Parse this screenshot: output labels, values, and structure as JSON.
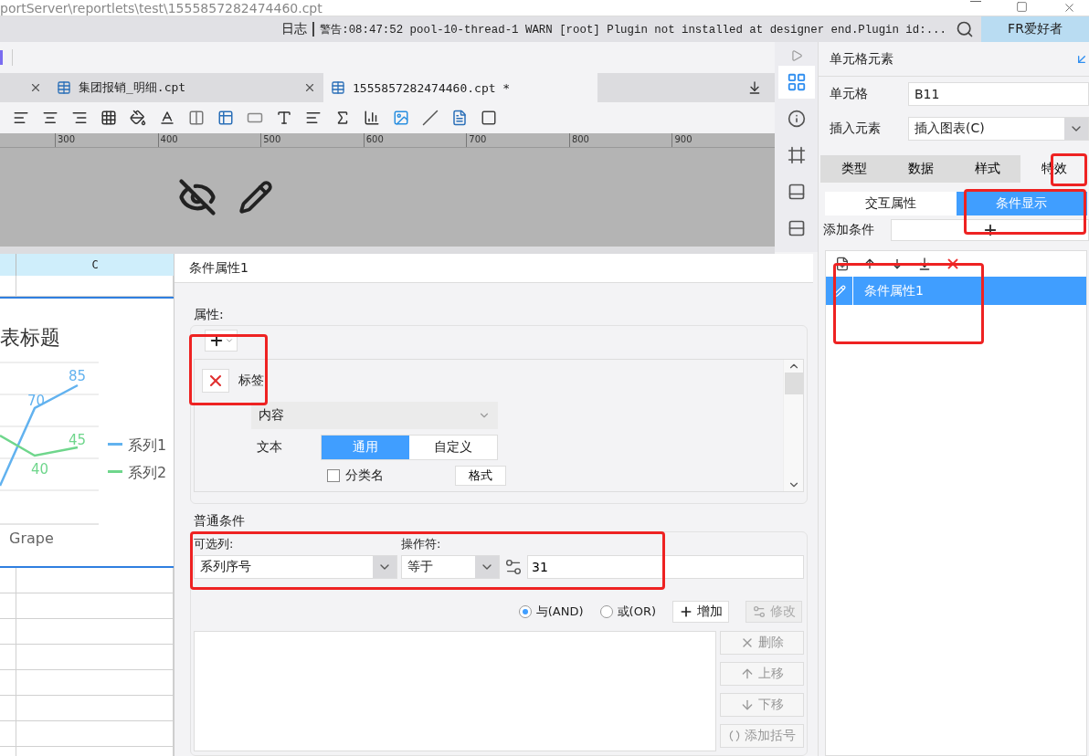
{
  "title_bar": {
    "path": "portServer\\reportlets\\test\\1555857282474460.cpt"
  },
  "log_bar": {
    "label": "日志",
    "message": "警告:08:47:52 pool-10-thread-1 WARN [root] Plugin not installed at designer end.Plugin id:...",
    "user": "FR爱好者"
  },
  "file_tabs": [
    {
      "selected": false
    },
    {
      "label": "集团报销_明细.cpt",
      "selected": false
    },
    {
      "label": "1555857282474460.cpt *",
      "selected": true
    }
  ],
  "ruler": {
    "ticks": [
      "300",
      "400",
      "500",
      "600",
      "700",
      "800",
      "900"
    ]
  },
  "sheet": {
    "column_header": "C"
  },
  "chart": {
    "title": "表标题",
    "category": "Grape",
    "point_labels": [
      {
        "text": "85"
      },
      {
        "text": "70"
      },
      {
        "text": "40"
      },
      {
        "text": "45"
      }
    ],
    "legend": [
      {
        "name": "系列1",
        "color": "#62b2ef"
      },
      {
        "name": "系列2",
        "color": "#6fd68c"
      }
    ]
  },
  "dialog": {
    "title": "条件属性1",
    "properties": {
      "legend": "属性:",
      "item": "标签",
      "content_select": "内容",
      "text_label": "文本",
      "text_modes": [
        {
          "label": "通用",
          "selected": true
        },
        {
          "label": "自定义",
          "selected": false
        }
      ],
      "checkbox": {
        "label": "分类名",
        "checked": false
      },
      "format_button": "格式"
    },
    "condition": {
      "legend": "普通条件",
      "column_label": "可选列:",
      "column_value": "系列序号",
      "operator_label": "操作符:",
      "operator_value": "等于",
      "value": "31",
      "logic": [
        {
          "label": "与(AND)",
          "selected": true
        },
        {
          "label": "或(OR)",
          "selected": false
        }
      ],
      "actions": [
        {
          "label": "增加",
          "disabled": false
        },
        {
          "label": "修改",
          "disabled": true
        }
      ],
      "side_buttons": [
        {
          "kind": "delete",
          "label": "删除",
          "disabled": true
        },
        {
          "kind": "up",
          "label": "上移",
          "disabled": true
        },
        {
          "kind": "down",
          "label": "下移",
          "disabled": true
        },
        {
          "kind": "bracket",
          "label": "添加括号",
          "disabled": true
        }
      ]
    }
  },
  "tool_strip": [
    {
      "kind": "cell",
      "selected": true
    },
    {
      "kind": "cell-attribute",
      "selected": false
    },
    {
      "kind": "frame",
      "selected": false
    },
    {
      "kind": "widget",
      "selected": false
    },
    {
      "kind": "form",
      "selected": false
    }
  ],
  "side_panel": {
    "title": "单元格元素",
    "cell_label": "单元格",
    "cell_value": "B11",
    "insert_label": "插入元素",
    "insert_value": "插入图表(C)",
    "tabs": [
      {
        "label": "类型",
        "selected": false
      },
      {
        "label": "数据",
        "selected": false
      },
      {
        "label": "样式",
        "selected": false
      },
      {
        "label": "特效",
        "selected": true
      }
    ],
    "subtabs": [
      {
        "label": "交互属性",
        "selected": false
      },
      {
        "label": "条件显示",
        "selected": true
      }
    ],
    "add_label": "添加条件",
    "conditions": [
      {
        "label": "条件属性1",
        "selected": true
      }
    ]
  }
}
